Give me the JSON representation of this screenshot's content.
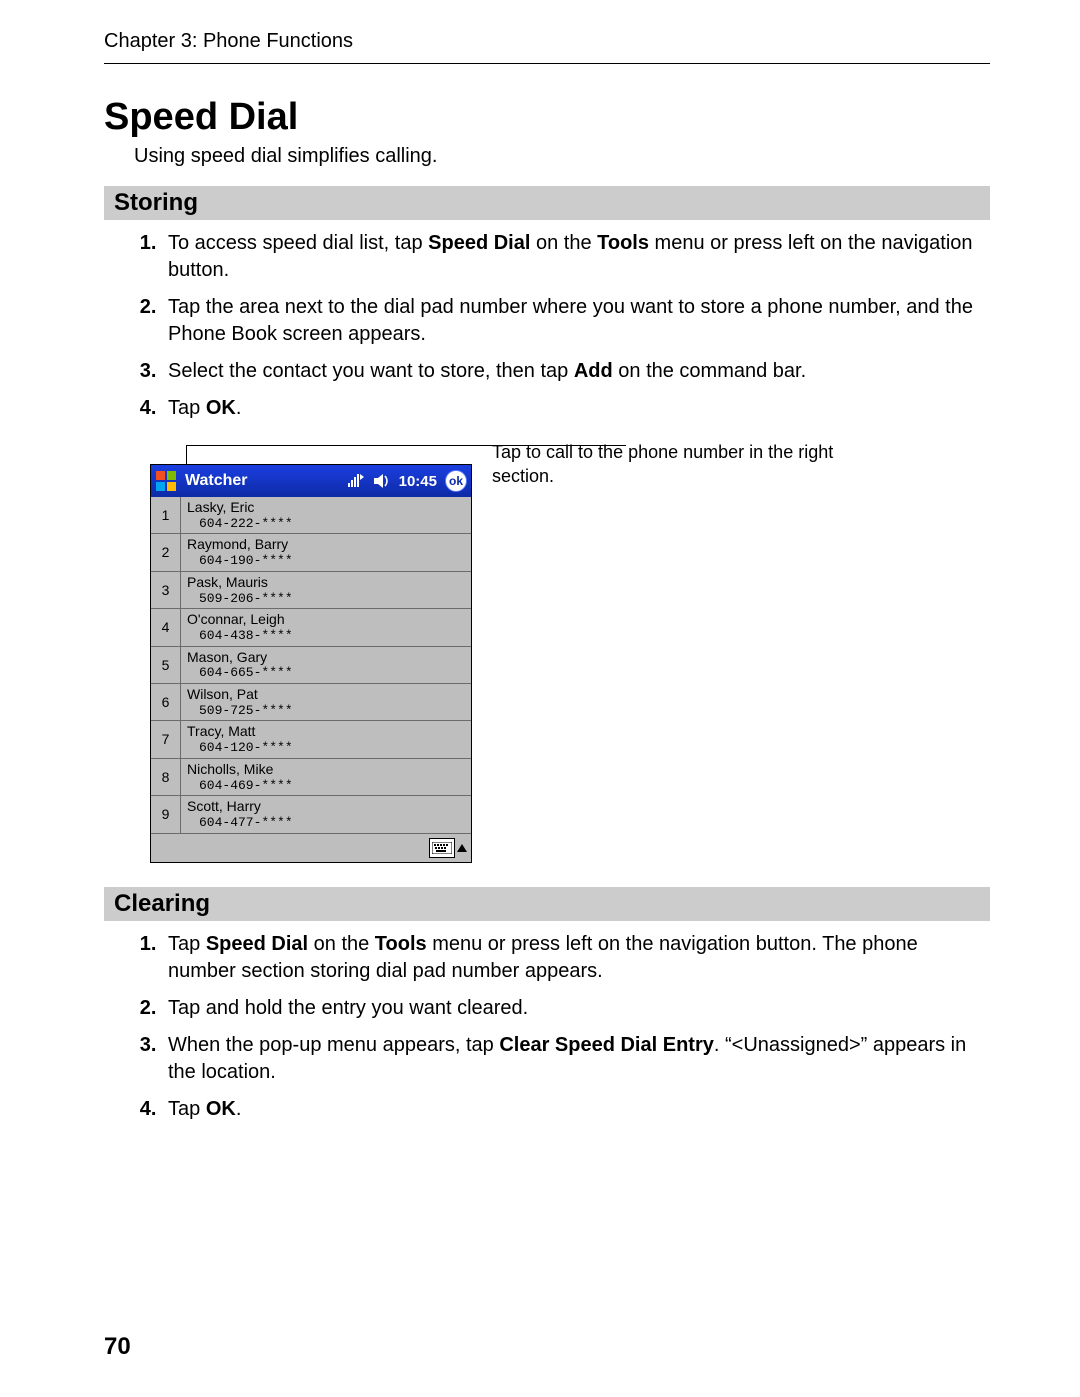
{
  "header": {
    "chapter": "Chapter 3: Phone Functions"
  },
  "title": "Speed Dial",
  "intro": "Using speed dial simplifies calling.",
  "section_storing": {
    "heading": "Storing",
    "steps": [
      {
        "pre": "To access speed dial list, tap ",
        "b1": "Speed Dial",
        "mid1": " on the ",
        "b2": "Tools",
        "post": " menu or press left on the navigation button."
      },
      {
        "pre": "Tap the area next to the dial pad number where you want to store a phone number, and the Phone Book screen appears."
      },
      {
        "pre": "Select the contact you want to store, then tap ",
        "b1": "Add",
        "post": " on the command bar."
      },
      {
        "pre": "Tap ",
        "b1": "OK",
        "post": "."
      }
    ]
  },
  "callout": "Tap to call to the phone number in the right section.",
  "screenshot": {
    "app_title": "Watcher",
    "time": "10:45",
    "ok_label": "ok",
    "entries": [
      {
        "n": "1",
        "name": "Lasky, Eric",
        "phone": "604-222-****"
      },
      {
        "n": "2",
        "name": "Raymond, Barry",
        "phone": "604-190-****"
      },
      {
        "n": "3",
        "name": "Pask, Mauris",
        "phone": "509-206-****"
      },
      {
        "n": "4",
        "name": "O'connar, Leigh",
        "phone": "604-438-****"
      },
      {
        "n": "5",
        "name": "Mason, Gary",
        "phone": "604-665-****"
      },
      {
        "n": "6",
        "name": "Wilson, Pat",
        "phone": "509-725-****"
      },
      {
        "n": "7",
        "name": "Tracy, Matt",
        "phone": "604-120-****"
      },
      {
        "n": "8",
        "name": "Nicholls, Mike",
        "phone": "604-469-****"
      },
      {
        "n": "9",
        "name": "Scott, Harry",
        "phone": "604-477-****"
      }
    ]
  },
  "section_clearing": {
    "heading": "Clearing",
    "steps": [
      {
        "pre": "Tap ",
        "b1": "Speed Dial",
        "mid1": " on the ",
        "b2": "Tools",
        "post": " menu or press left on the navigation button. The phone number section storing dial pad number appears."
      },
      {
        "pre": "Tap and hold the entry you want cleared."
      },
      {
        "pre": "When the pop-up menu appears, tap ",
        "b1": "Clear Speed Dial Entry",
        "post": ". “<Unassigned>” appears in the location."
      },
      {
        "pre": "Tap ",
        "b1": "OK",
        "post": "."
      }
    ]
  },
  "page_number": "70"
}
